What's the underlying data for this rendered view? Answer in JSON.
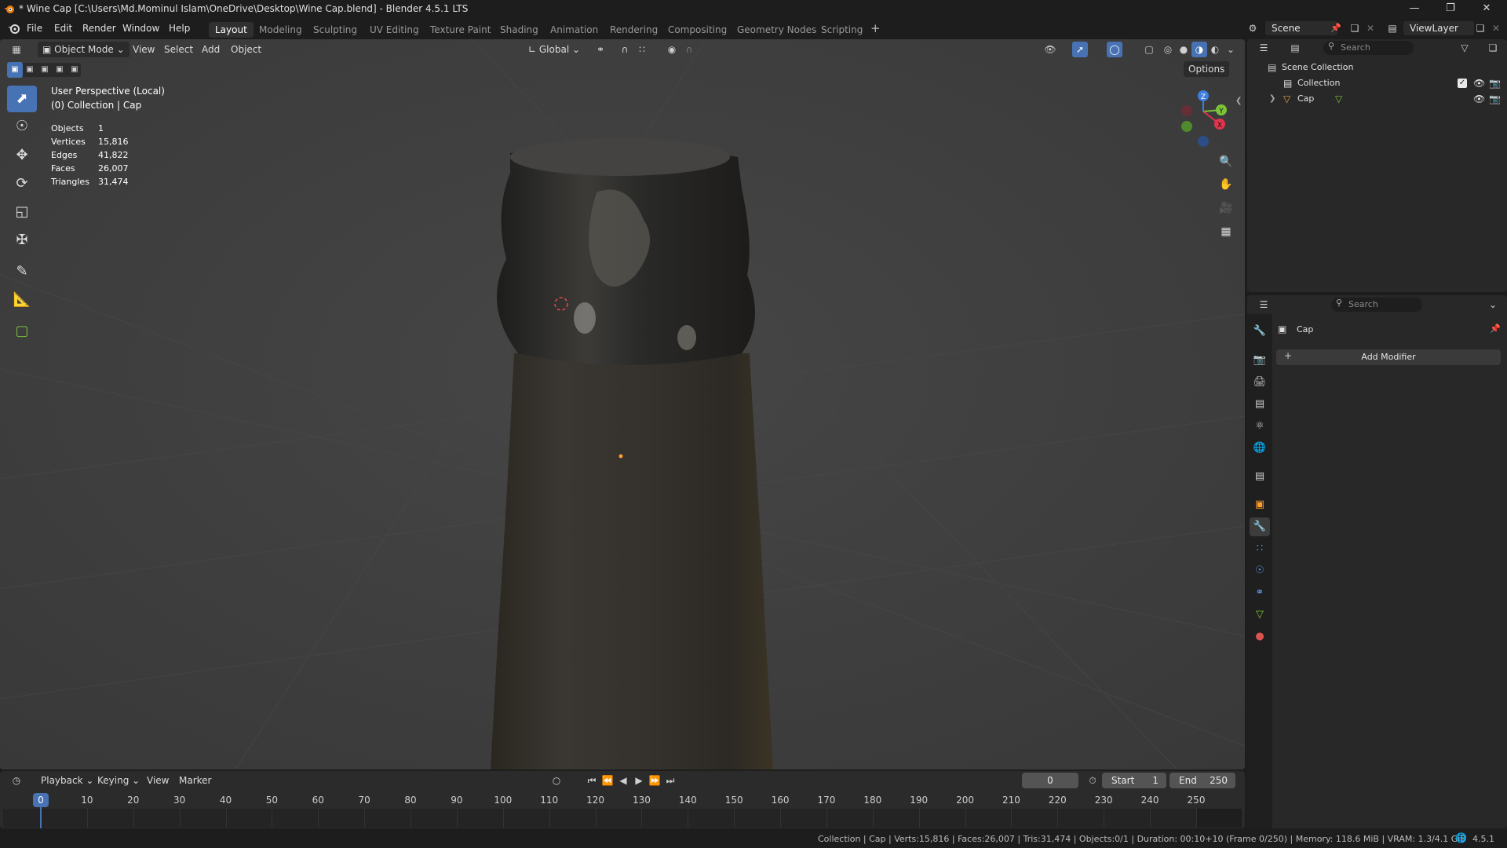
{
  "window": {
    "title": "* Wine Cap [C:\\Users\\Md.Mominul Islam\\OneDrive\\Desktop\\Wine Cap.blend] - Blender 4.5.1 LTS",
    "min_icon": "minimize-icon",
    "max_icon": "maximize-icon",
    "close_icon": "close-icon"
  },
  "menu": [
    "File",
    "Edit",
    "Render",
    "Window",
    "Help"
  ],
  "workspaces": [
    {
      "label": "Layout",
      "active": true
    },
    {
      "label": "Modeling"
    },
    {
      "label": "Sculpting"
    },
    {
      "label": "UV Editing"
    },
    {
      "label": "Texture Paint"
    },
    {
      "label": "Shading"
    },
    {
      "label": "Animation"
    },
    {
      "label": "Rendering"
    },
    {
      "label": "Compositing"
    },
    {
      "label": "Geometry Nodes"
    },
    {
      "label": "Scripting"
    }
  ],
  "top_right": {
    "scene_label": "Scene",
    "view_layer_label": "ViewLayer"
  },
  "viewport_header": {
    "mode": "Object Mode",
    "menus": [
      "View",
      "Select",
      "Add",
      "Object"
    ],
    "orientation": "Global",
    "options": "Options"
  },
  "viewport_overlay": {
    "perspective": "User Perspective (Local)",
    "collection": "(0) Collection | Cap",
    "stats": [
      {
        "label": "Objects",
        "value": "1"
      },
      {
        "label": "Vertices",
        "value": "15,816"
      },
      {
        "label": "Edges",
        "value": "41,822"
      },
      {
        "label": "Faces",
        "value": "26,007"
      },
      {
        "label": "Triangles",
        "value": "31,474"
      }
    ]
  },
  "gizmo": {
    "z": "Z",
    "y": "Y",
    "x": "X"
  },
  "outliner": {
    "search_placeholder": "Search",
    "scene_collection": "Scene Collection",
    "collection": "Collection",
    "object": "Cap"
  },
  "properties": {
    "search_placeholder": "Search",
    "object_name": "Cap",
    "add_modifier": "Add Modifier"
  },
  "timeline": {
    "menus": [
      "Playback",
      "Keying",
      "View",
      "Marker"
    ],
    "current_frame": "0",
    "start_label": "Start",
    "start_value": "1",
    "end_label": "End",
    "end_value": "250",
    "ticks": [
      "0",
      "10",
      "20",
      "30",
      "40",
      "50",
      "60",
      "70",
      "80",
      "90",
      "100",
      "110",
      "120",
      "130",
      "140",
      "150",
      "160",
      "170",
      "180",
      "190",
      "200",
      "210",
      "220",
      "230",
      "240",
      "250"
    ]
  },
  "statusbar": {
    "text": "Collection | Cap | Verts:15,816 | Faces:26,007 | Tris:31,474 | Objects:0/1 | Duration: 00:10+10 (Frame 0/250) | Memory: 118.6 MiB | VRAM: 1.3/4.1 GiB",
    "version": "4.5.1"
  },
  "colors": {
    "accent": "#4772b3",
    "viewport_bg": "#3d3d3d",
    "panel_bg": "#282828",
    "x_axis": "#e2344a",
    "y_axis": "#7cc437",
    "z_axis": "#3f7ee0"
  }
}
